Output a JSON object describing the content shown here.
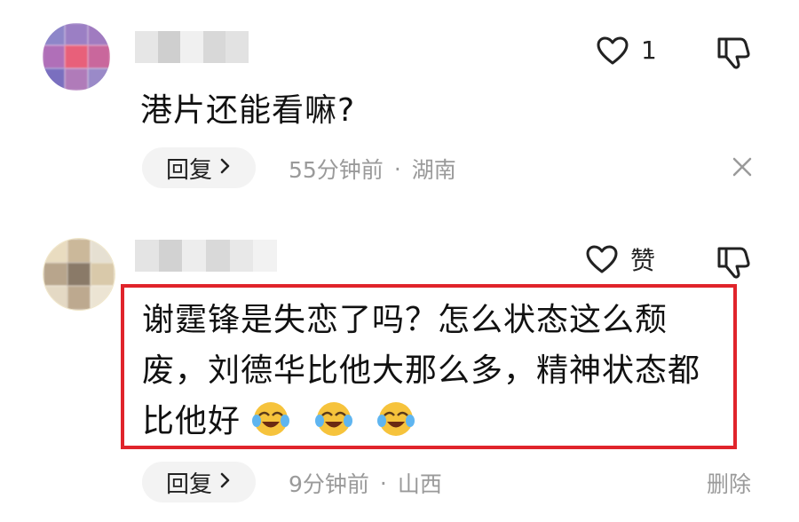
{
  "comments": [
    {
      "like_count": "1",
      "text": "港片还能看嘛?",
      "reply_label": "回复",
      "time": "55分钟前",
      "separator": "·",
      "location": "湖南"
    },
    {
      "like_label": "赞",
      "text_line1": "谢霆锋是失恋了吗？怎么状态这么颓",
      "text_line2": "废，刘德华比他大那么多，精神状态都",
      "text_line3": "比他好",
      "reply_label": "回复",
      "time": "9分钟前",
      "separator": "·",
      "location": "山西",
      "delete_label": "删除"
    }
  ],
  "colors": {
    "highlight_border": "#e0242b",
    "meta_text": "#9a9a9a",
    "reply_bg": "#f3f3f3"
  },
  "icons": [
    "heart-outline-icon",
    "thumbs-down-icon",
    "chevron-right-icon",
    "close-icon",
    "tears-of-joy-emoji"
  ]
}
